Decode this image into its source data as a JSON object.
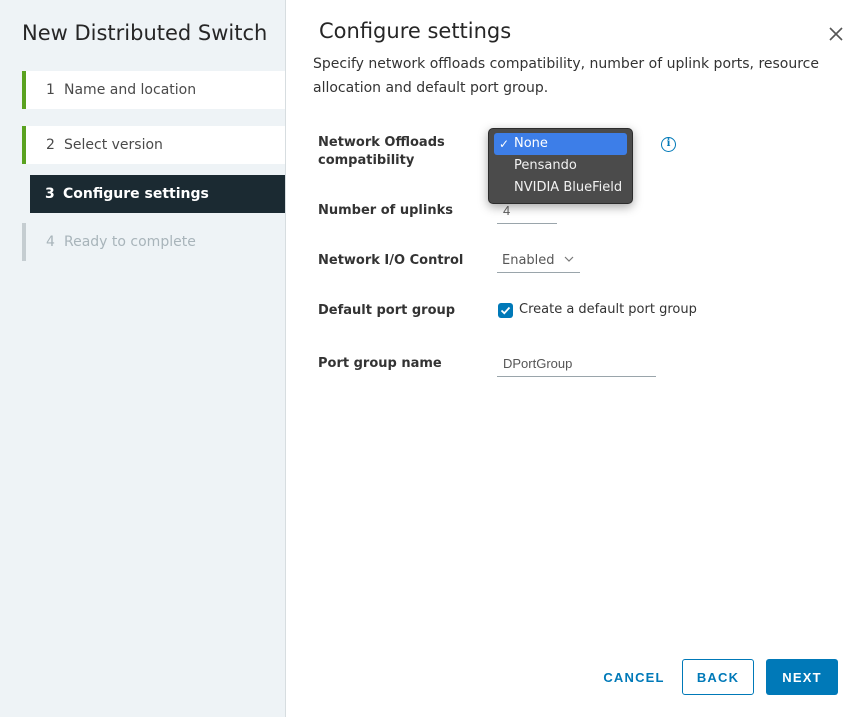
{
  "wizard": {
    "title": "New Distributed Switch",
    "steps": [
      {
        "num": "1",
        "label": "Name and location"
      },
      {
        "num": "2",
        "label": "Select version"
      },
      {
        "num": "3",
        "label": "Configure settings"
      },
      {
        "num": "4",
        "label": "Ready to complete"
      }
    ]
  },
  "page": {
    "title": "Configure settings",
    "description": "Specify network offloads compatibility, number of uplink ports, resource allocation and default port group."
  },
  "form": {
    "offloads": {
      "label": "Network Offloads compatibility",
      "options": [
        "None",
        "Pensando",
        "NVIDIA BlueField"
      ],
      "selected": "None",
      "check": "✓"
    },
    "uplinks": {
      "label": "Number of uplinks",
      "value": "4"
    },
    "nioc": {
      "label": "Network I/O Control",
      "value": "Enabled"
    },
    "default_pg": {
      "label": "Default port group",
      "checkbox_label": "Create a default port group",
      "checked": true
    },
    "pg_name": {
      "label": "Port group name",
      "value": "DPortGroup"
    }
  },
  "footer": {
    "cancel": "CANCEL",
    "back": "BACK",
    "next": "NEXT"
  },
  "icons": {
    "info": "info-icon",
    "close": "close-icon",
    "chevron": "chevron-down-icon",
    "check": "checkmark-icon"
  },
  "colors": {
    "accent": "#0079b8",
    "active_step_bg": "#1b2a32",
    "done_bar": "#5aa220",
    "menu_bg": "#4b4b4b",
    "menu_selected": "#3d7ee8"
  }
}
